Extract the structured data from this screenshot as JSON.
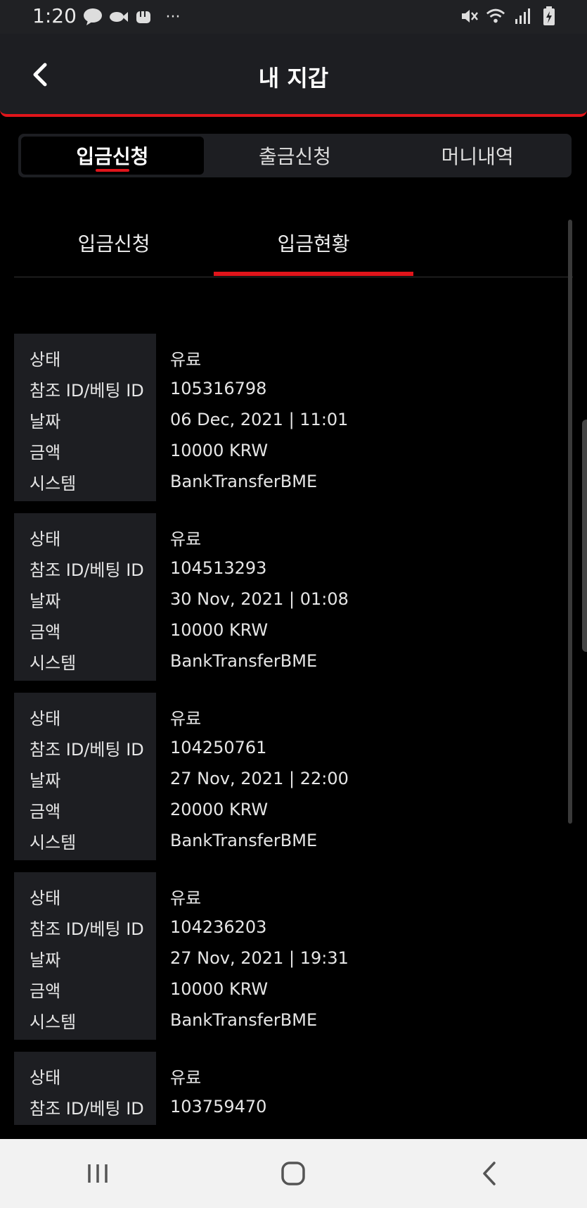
{
  "status_bar": {
    "time": "1:20",
    "left_icons": [
      "talk-icon",
      "fish-icon",
      "fist-icon",
      "more-icon"
    ],
    "more_glyph": "···",
    "right_icons": [
      "mute-icon",
      "wifi-icon",
      "signal-icon",
      "battery-icon"
    ]
  },
  "header": {
    "title": "내 지갑",
    "back_icon": "chevron-left-icon"
  },
  "top_tabs": [
    {
      "label": "입금신청",
      "active": true
    },
    {
      "label": "출금신청",
      "active": false
    },
    {
      "label": "머니내역",
      "active": false
    }
  ],
  "sub_tabs": [
    {
      "label": "입금신청",
      "active": false
    },
    {
      "label": "입금현황",
      "active": true
    }
  ],
  "labels": {
    "status": "상태",
    "ref_id": "참조 ID/베팅 ID",
    "date": "날짜",
    "amount": "금액",
    "system": "시스템"
  },
  "records": [
    {
      "status": "유료",
      "ref_id": "105316798",
      "date": "06 Dec, 2021 | 11:01",
      "amount": "10000 KRW",
      "system": "BankTransferBME"
    },
    {
      "status": "유료",
      "ref_id": "104513293",
      "date": "30 Nov, 2021 | 01:08",
      "amount": "10000 KRW",
      "system": "BankTransferBME"
    },
    {
      "status": "유료",
      "ref_id": "104250761",
      "date": "27 Nov, 2021 | 22:00",
      "amount": "20000 KRW",
      "system": "BankTransferBME"
    },
    {
      "status": "유료",
      "ref_id": "104236203",
      "date": "27 Nov, 2021 | 19:31",
      "amount": "10000 KRW",
      "system": "BankTransferBME"
    },
    {
      "status": "유료",
      "ref_id": "103759470"
    }
  ],
  "nav_bar": [
    "recents-icon",
    "home-icon",
    "back-icon"
  ],
  "colors": {
    "accent": "#e0151b",
    "panel": "#1d1e22",
    "background": "#000000"
  }
}
